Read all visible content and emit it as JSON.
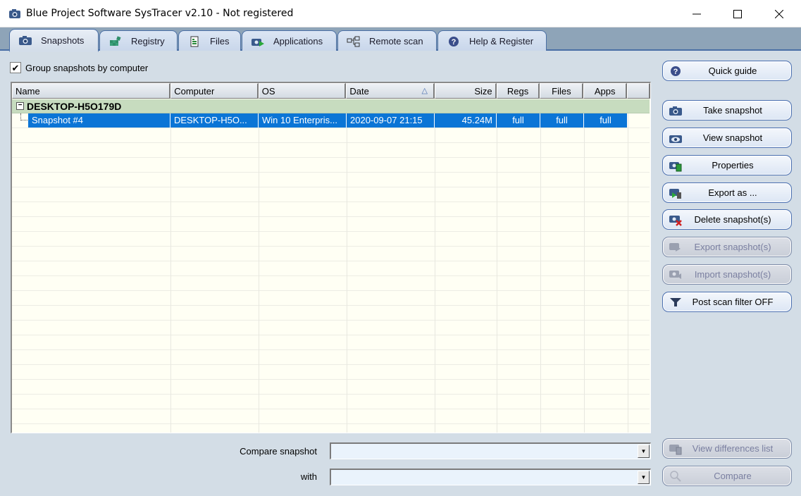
{
  "window": {
    "title": "Blue Project Software SysTracer v2.10 - Not registered",
    "controls": {
      "minimize": "minimize",
      "maximize": "maximize",
      "close": "close"
    }
  },
  "tabs": [
    {
      "label": "Snapshots",
      "icon": "camera-icon",
      "active": true
    },
    {
      "label": "Registry",
      "icon": "registry-icon",
      "active": false
    },
    {
      "label": "Files",
      "icon": "file-icon",
      "active": false
    },
    {
      "label": "Applications",
      "icon": "applications-icon",
      "active": false
    },
    {
      "label": "Remote scan",
      "icon": "network-icon",
      "active": false
    },
    {
      "label": "Help & Register",
      "icon": "help-icon",
      "active": false
    }
  ],
  "options": {
    "group_by_computer_label": "Group snapshots by computer",
    "group_by_computer_checked": true
  },
  "grid": {
    "columns": [
      "Name",
      "Computer",
      "OS",
      "Date",
      "Size",
      "Regs",
      "Files",
      "Apps"
    ],
    "sort_column": "Date",
    "sort_glyph": "△",
    "groups": [
      {
        "name": "DESKTOP-H5O179D",
        "expander": "−",
        "rows": [
          {
            "name": "Snapshot #4",
            "computer": "DESKTOP-H5O...",
            "os": "Win 10 Enterpris...",
            "date": "2020-09-07 21:15",
            "size": "45.24M",
            "regs": "full",
            "files": "full",
            "apps": "full",
            "selected": true
          }
        ]
      }
    ]
  },
  "actions": [
    {
      "label": "Quick guide",
      "icon": "help-icon",
      "enabled": true
    },
    {
      "label": "Take snapshot",
      "icon": "camera-icon",
      "enabled": true
    },
    {
      "label": "View snapshot",
      "icon": "view-snapshot-icon",
      "enabled": true
    },
    {
      "label": "Properties",
      "icon": "properties-icon",
      "enabled": true
    },
    {
      "label": "Export as ...",
      "icon": "export-as-icon",
      "enabled": true
    },
    {
      "label": "Delete snapshot(s)",
      "icon": "delete-snapshot-icon",
      "enabled": true
    },
    {
      "label": "Export snapshot(s)",
      "icon": "export-snapshot-icon",
      "enabled": false
    },
    {
      "label": "Import snapshot(s)",
      "icon": "import-snapshot-icon",
      "enabled": false
    },
    {
      "label": "Post scan filter OFF",
      "icon": "filter-icon",
      "enabled": true
    }
  ],
  "compare": {
    "snapshot_label": "Compare snapshot",
    "snapshot_value": "",
    "with_label": "with",
    "with_value": "",
    "view_differences_label": "View differences list",
    "compare_label": "Compare"
  },
  "colors": {
    "selection": "#0b75d6",
    "group_row": "#c7dcbf",
    "grid_bg": "#fffff4",
    "panel_bg": "#d3dde6",
    "button_border": "#4a6fb0"
  }
}
